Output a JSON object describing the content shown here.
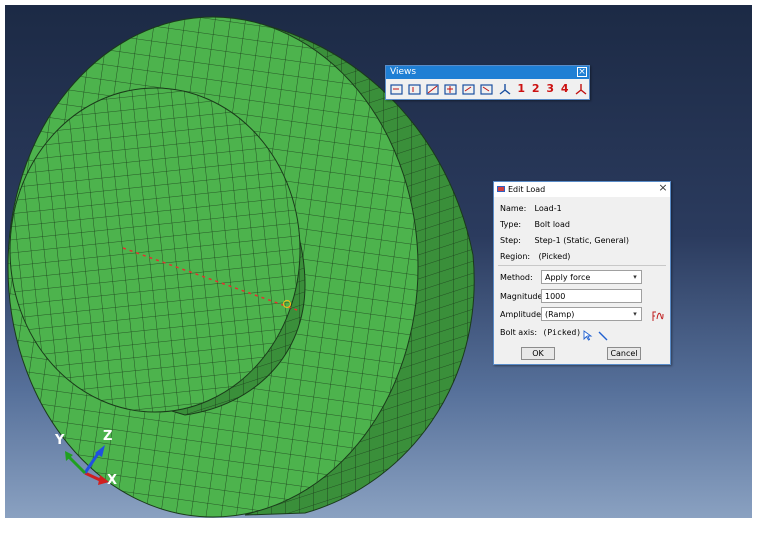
{
  "views_toolbar": {
    "title": "Views",
    "close": "×",
    "numbers": [
      "1",
      "2",
      "3",
      "4"
    ]
  },
  "edit_load": {
    "title": "Edit Load",
    "close": "×",
    "name_label": "Name:",
    "name_value": "Load-1",
    "type_label": "Type:",
    "type_value": "Bolt load",
    "step_label": "Step:",
    "step_value": "Step-1 (Static, General)",
    "region_label": "Region:",
    "region_value": "(Picked)",
    "method_label": "Method:",
    "method_value": "Apply force",
    "magnitude_label": "Magnitude:",
    "magnitude_value": "1000",
    "amplitude_label": "Amplitude:",
    "amplitude_value": "(Ramp)",
    "bolt_axis_label": "Bolt axis:",
    "bolt_axis_value": "(Picked)",
    "ok_label": "OK",
    "cancel_label": "Cancel"
  },
  "triad": {
    "x": "X",
    "y": "Y",
    "z": "Z"
  },
  "colors": {
    "mesh_face": "#4db34d",
    "mesh_side": "#3a8f3a",
    "mesh_lines": "#1a3a1a",
    "background_top": "#1c2a45",
    "background_bottom": "#8aa1c1",
    "title_blue": "#1f7fd4"
  }
}
